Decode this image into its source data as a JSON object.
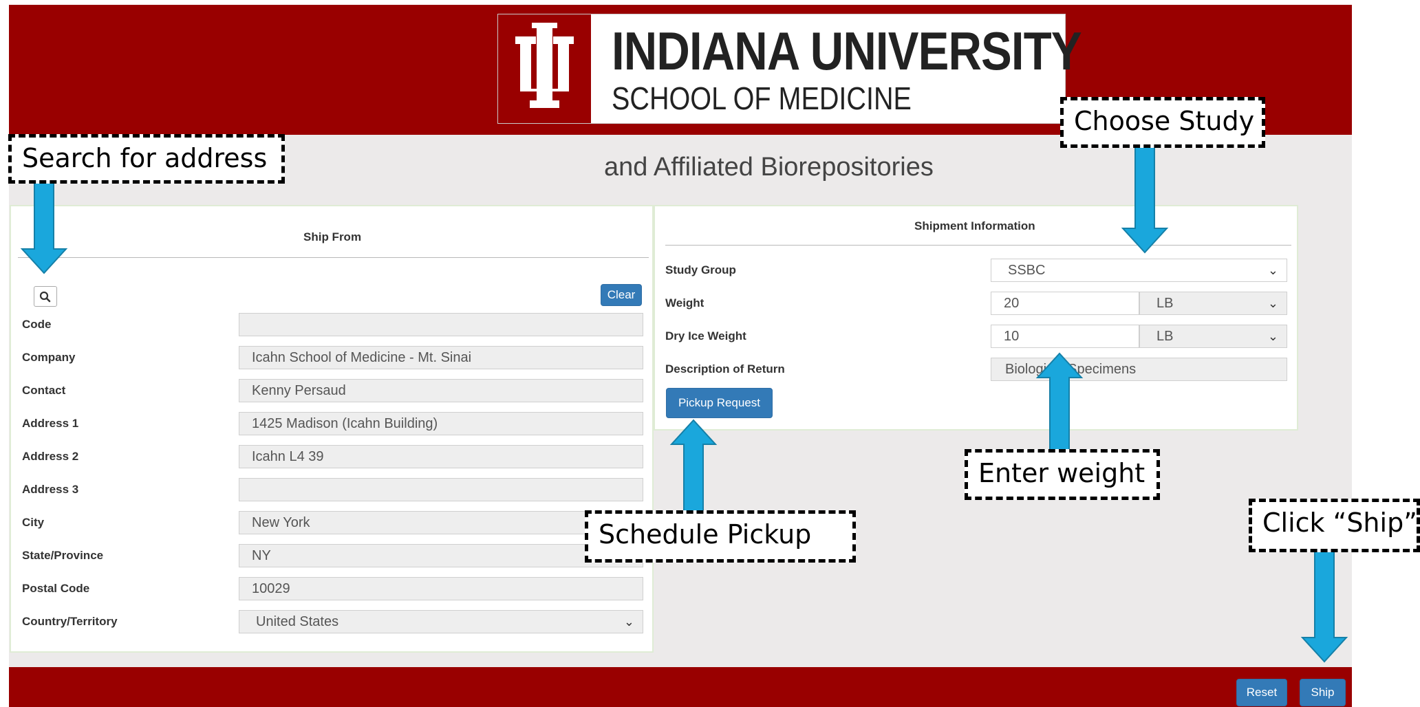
{
  "header": {
    "logo_title": "INDIANA UNIVERSITY",
    "logo_subtitle": "SCHOOL OF MEDICINE",
    "subtitle": "and Affiliated Biorepositories"
  },
  "colors": {
    "brand": "#990000",
    "button": "#337ab7",
    "arrow": "#1aa7dc"
  },
  "ship_from": {
    "title": "Ship From",
    "search_icon": "search-icon",
    "clear_label": "Clear",
    "fields": [
      {
        "label": "Code",
        "value": ""
      },
      {
        "label": "Company",
        "value": "Icahn School of Medicine - Mt. Sinai"
      },
      {
        "label": "Contact",
        "value": "Kenny Persaud"
      },
      {
        "label": "Address 1",
        "value": "1425 Madison (Icahn Building)"
      },
      {
        "label": "Address 2",
        "value": "Icahn L4 39"
      },
      {
        "label": "Address 3",
        "value": ""
      },
      {
        "label": "City",
        "value": "New York"
      },
      {
        "label": "State/Province",
        "value": "NY"
      },
      {
        "label": "Postal Code",
        "value": "10029"
      },
      {
        "label": "Country/Territory",
        "value": "United States"
      }
    ]
  },
  "shipment": {
    "title": "Shipment Information",
    "study_group_label": "Study Group",
    "study_group_value": "SSBC",
    "weight_label": "Weight",
    "weight_value": "20",
    "weight_unit": "LB",
    "dry_ice_label": "Dry Ice Weight",
    "dry_ice_value": "10",
    "dry_ice_unit": "LB",
    "description_label": "Description of Return",
    "description_value": "Biological Specimens",
    "pickup_label": "Pickup Request"
  },
  "footer": {
    "reset_label": "Reset",
    "ship_label": "Ship"
  },
  "callouts": {
    "search": "Search for address",
    "study": "Choose Study",
    "weight": "Enter weight",
    "pickup": "Schedule Pickup",
    "ship": "Click “Ship”"
  }
}
